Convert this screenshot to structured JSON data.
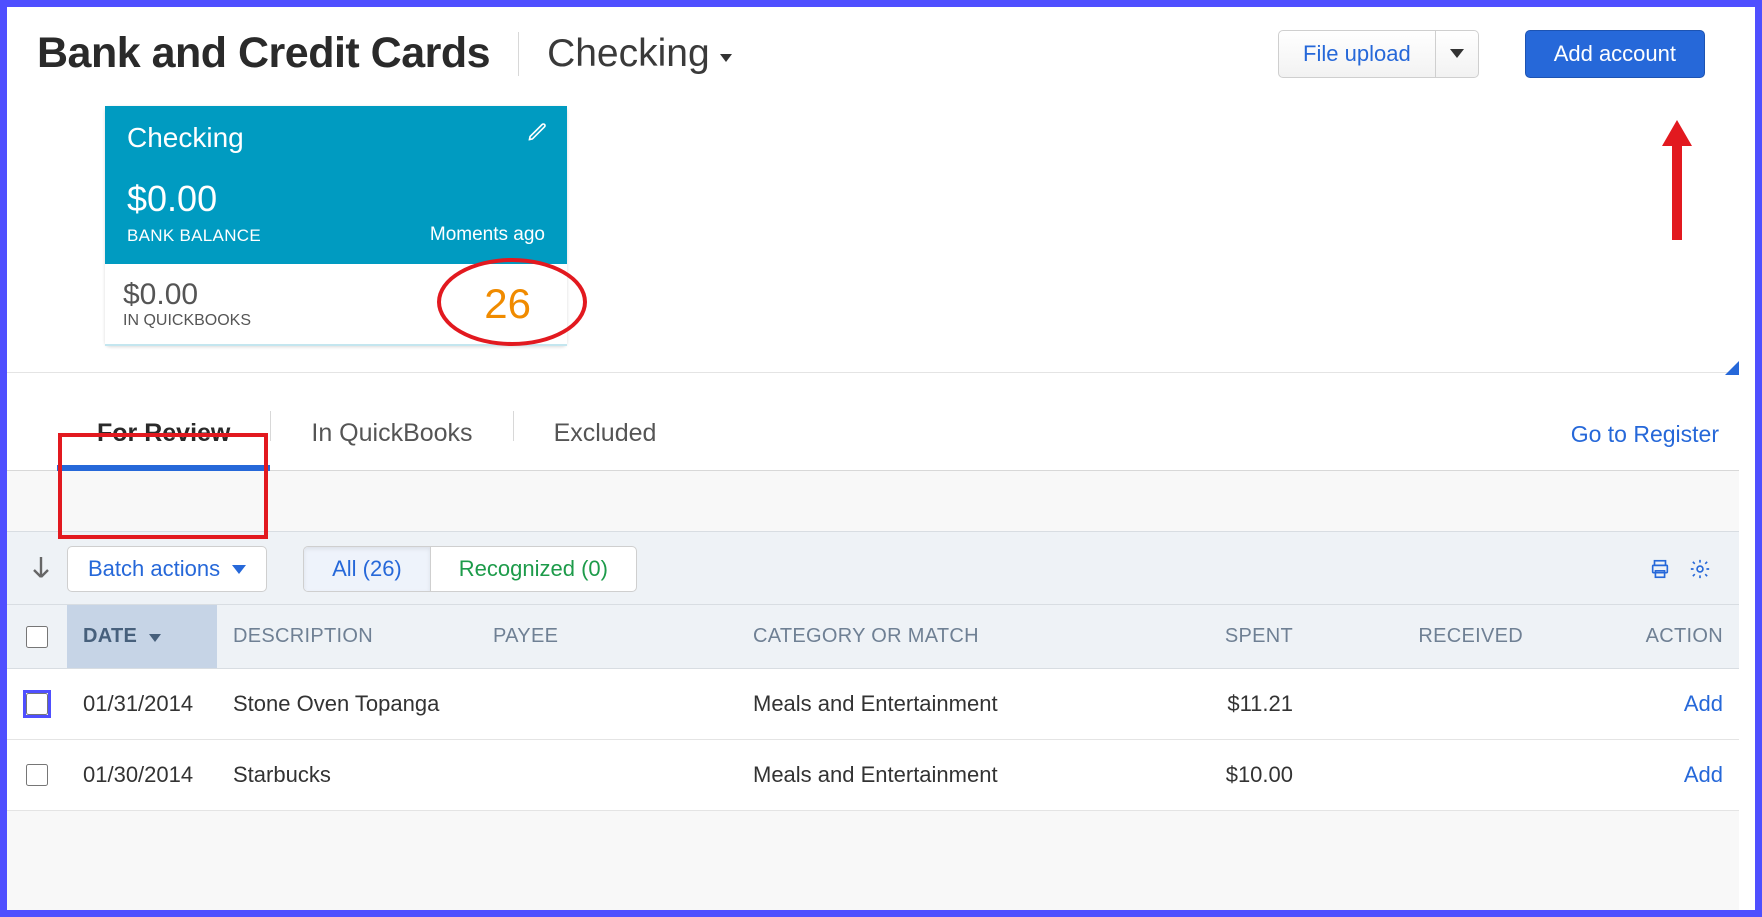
{
  "header": {
    "title": "Bank and Credit Cards",
    "account_selector": "Checking",
    "file_upload_label": "File upload",
    "add_account_label": "Add account"
  },
  "card": {
    "account_name": "Checking",
    "bank_balance_amount": "$0.00",
    "bank_balance_label": "BANK BALANCE",
    "updated": "Moments ago",
    "qb_balance_amount": "$0.00",
    "qb_balance_label": "IN QUICKBOOKS",
    "pending_count": "26"
  },
  "tabs": {
    "for_review": "For Review",
    "in_quickbooks": "In QuickBooks",
    "excluded": "Excluded",
    "go_to_register": "Go to Register"
  },
  "toolbar": {
    "batch_actions": "Batch actions",
    "filter_all": "All (26)",
    "filter_recognized": "Recognized (0)"
  },
  "table": {
    "headers": {
      "date": "DATE",
      "description": "DESCRIPTION",
      "payee": "PAYEE",
      "category": "CATEGORY OR MATCH",
      "spent": "SPENT",
      "received": "RECEIVED",
      "action": "ACTION"
    },
    "rows": [
      {
        "date": "01/31/2014",
        "description": "Stone Oven Topanga",
        "payee": "",
        "category": "Meals and Entertainment",
        "spent": "$11.21",
        "received": "",
        "action": "Add"
      },
      {
        "date": "01/30/2014",
        "description": "Starbucks",
        "payee": "",
        "category": "Meals and Entertainment",
        "spent": "$10.00",
        "received": "",
        "action": "Add"
      }
    ]
  }
}
